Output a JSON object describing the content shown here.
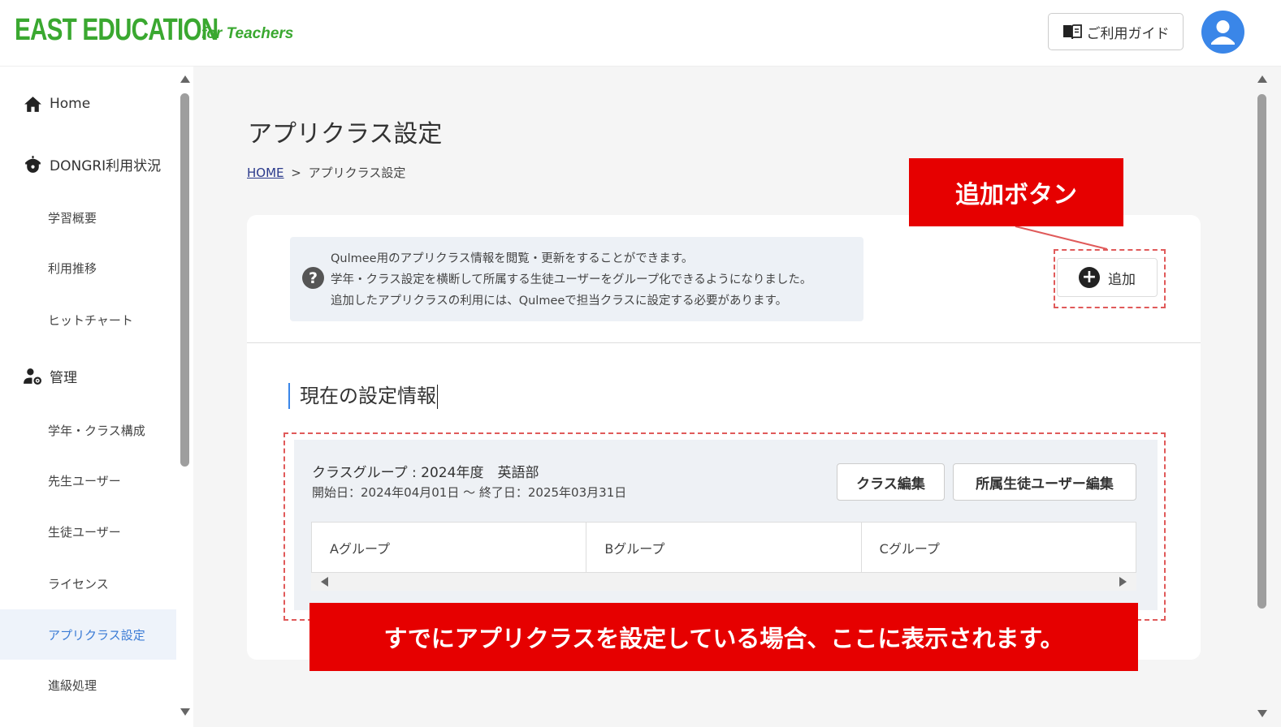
{
  "header": {
    "logo": "EAST EDUCATION",
    "logo_sub": "for Teachers",
    "guide_label": "ご利用ガイド"
  },
  "sidebar": {
    "home": "Home",
    "dongri": "DONGRI利用状況",
    "dongri_items": [
      "学習概要",
      "利用推移",
      "ヒットチャート"
    ],
    "admin": "管理",
    "admin_items": [
      "学年・クラス構成",
      "先生ユーザー",
      "生徒ユーザー",
      "ライセンス",
      "アプリクラス設定",
      "進級処理"
    ]
  },
  "page": {
    "title": "アプリクラス設定",
    "breadcrumb_home": "HOME",
    "breadcrumb_sep": ">",
    "breadcrumb_current": "アプリクラス設定"
  },
  "info": {
    "icon": "question-icon",
    "lines": [
      "Qulmee用のアプリクラス情報を閲覧・更新をすることができます。",
      "学年・クラス設定を横断して所属する生徒ユーザーをグループ化できるようになりました。",
      "追加したアプリクラスの利用には、Qulmeeで担当クラスに設定する必要があります。"
    ]
  },
  "add_button_label": "追加",
  "section_heading": "現在の設定情報",
  "class_group": {
    "title": "クラスグループ : 2024年度　英語部",
    "dates": "開始日：2024年04月01日 〜 終了日：2025年03月31日",
    "edit_class_label": "クラス編集",
    "edit_students_label": "所属生徒ユーザー編集",
    "groups": [
      "Aグループ",
      "Bグループ",
      "Cグループ"
    ]
  },
  "annotations": {
    "add_callout": "追加ボタン",
    "bottom_callout": "すでにアプリクラスを設定している場合、ここに表示されます。",
    "callout_color": "#e60000"
  },
  "colors": {
    "brand_green": "#3aa830",
    "accent_blue": "#3a86e8",
    "active_bg": "#eef3fa"
  }
}
